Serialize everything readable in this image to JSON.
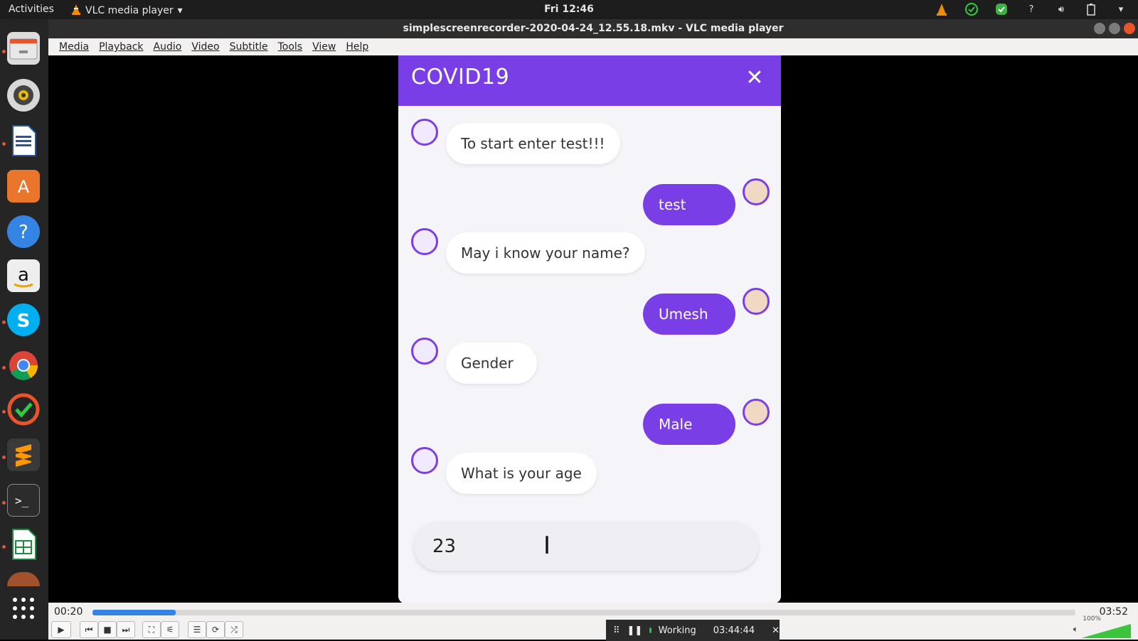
{
  "topbar": {
    "activities": "Activities",
    "app_name": "VLC media player",
    "clock": "Fri 12:46",
    "tray_icons": [
      "vlc-cone-icon",
      "checkmark-circle-icon",
      "green-check-icon",
      "help-icon",
      "volume-icon",
      "battery-icon",
      "chevron-down-icon"
    ]
  },
  "window": {
    "title": "simplescreenrecorder-2020-04-24_12.55.18.mkv - VLC media player"
  },
  "dock": {
    "items": [
      "file-manager-icon",
      "speaker-icon",
      "writer-icon",
      "software-store-icon",
      "help-icon",
      "amazon-icon",
      "skype-icon",
      "chrome-icon",
      "check-app-icon",
      "sublime-icon",
      "terminal-icon",
      "calc-icon",
      "partial-app-icon",
      "show-apps-icon"
    ],
    "running_dots": [
      true,
      false,
      true,
      false,
      false,
      false,
      true,
      true,
      true,
      true,
      true,
      true,
      false,
      false
    ]
  },
  "menu": {
    "items": [
      "Media",
      "Playback",
      "Audio",
      "Video",
      "Subtitle",
      "Tools",
      "View",
      "Help"
    ]
  },
  "chat": {
    "title": "COVID19",
    "close_label": "✕",
    "messages": [
      {
        "from": "bot",
        "text": "To start enter test!!!"
      },
      {
        "from": "user",
        "text": "test"
      },
      {
        "from": "bot",
        "text": "May i know your name?"
      },
      {
        "from": "user",
        "text": "Umesh"
      },
      {
        "from": "bot",
        "text": "Gender"
      },
      {
        "from": "user",
        "text": "Male"
      },
      {
        "from": "bot",
        "text": "What is your age"
      }
    ],
    "input_value": "23",
    "accent": "#7a3ee6"
  },
  "player": {
    "elapsed": "00:20",
    "total": "03:52",
    "progress": 0.085,
    "volume_label": "100%",
    "volume": 1.0
  },
  "recorder": {
    "status": "Working",
    "time": "03:44:44",
    "close_label": "✕"
  }
}
